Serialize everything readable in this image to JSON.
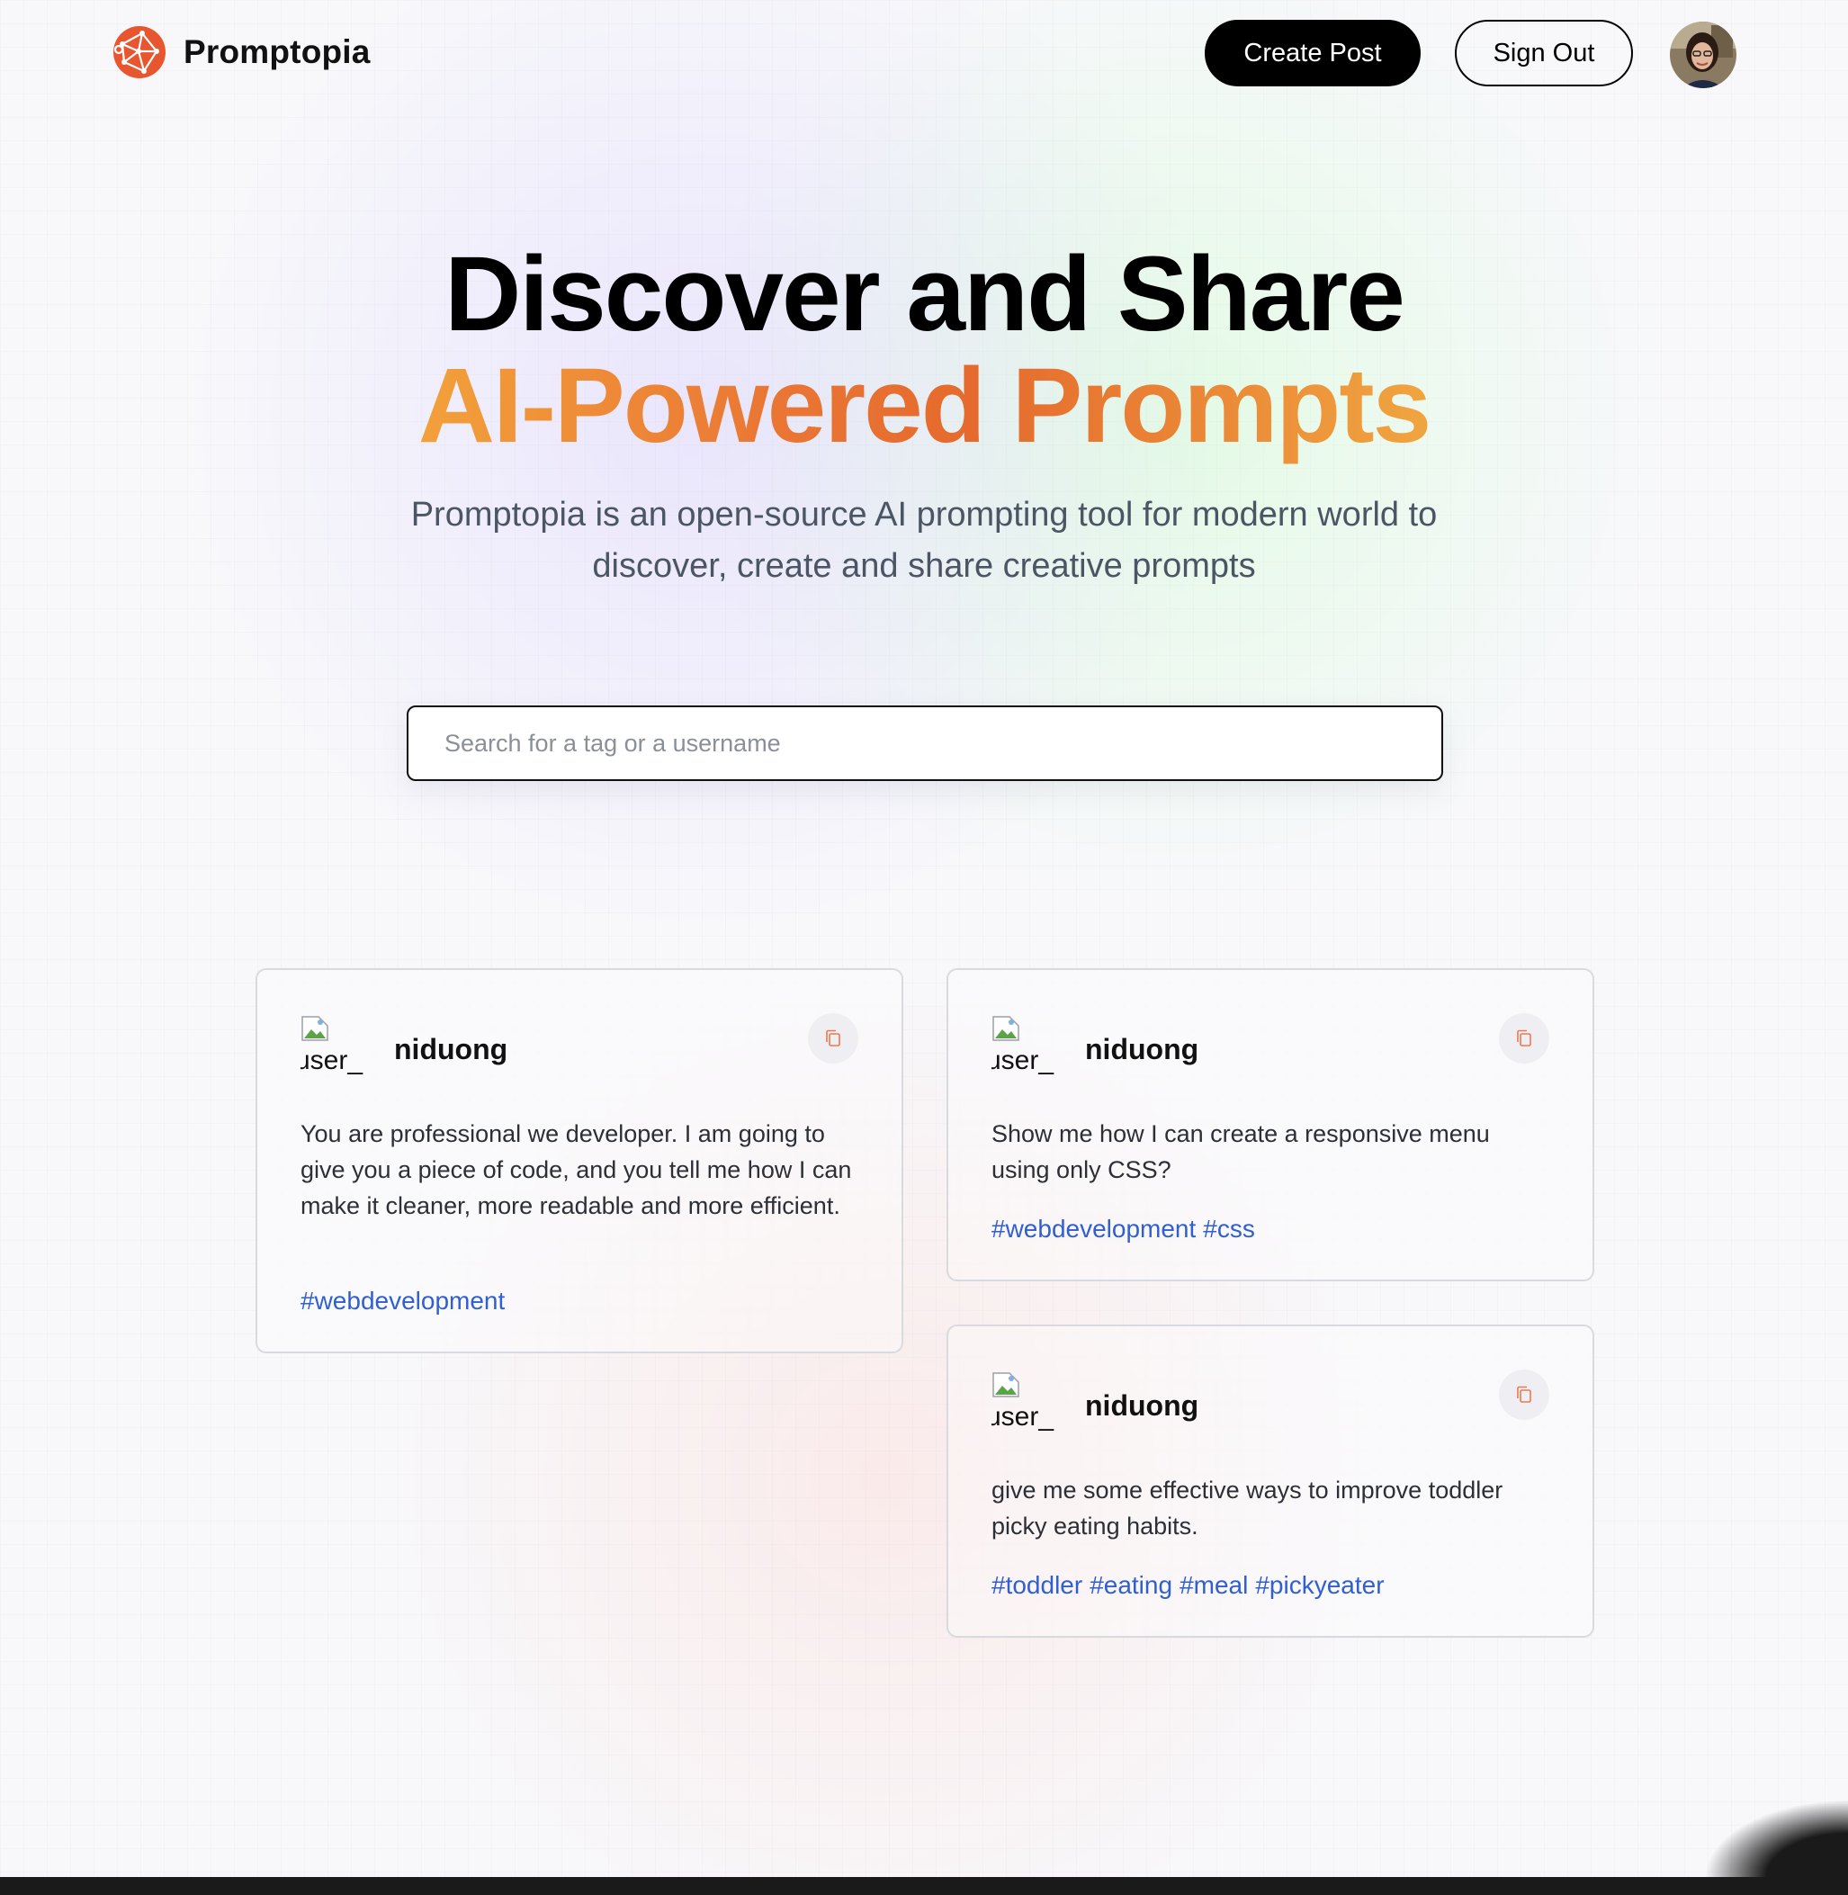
{
  "nav": {
    "brand": "Promptopia",
    "create_label": "Create Post",
    "signout_label": "Sign Out",
    "accent": "#e8562f"
  },
  "hero": {
    "line1": "Discover and Share",
    "line2": "AI-Powered Prompts",
    "subtitle": "Promptopia is an open-source AI prompting tool for modern world to discover, create and share creative prompts"
  },
  "search": {
    "placeholder": "Search for a tag or a username",
    "value": ""
  },
  "cards": [
    {
      "user_alt": "user_",
      "username": "niduong",
      "prompt": "You are professional we developer. I am going to give you a piece of code, and you tell me how I can make it cleaner, more readable and more efficient.",
      "tags": [
        "#webdevelopment"
      ]
    },
    {
      "user_alt": "user_",
      "username": "niduong",
      "prompt": "Show me how I can create a responsive menu using only CSS?",
      "tags": [
        "#webdevelopment",
        "#css"
      ]
    },
    {
      "user_alt": "user_",
      "username": "niduong",
      "prompt": "give me some effective ways to improve toddler picky eating habits.",
      "tags": [
        "#toddler",
        "#eating",
        "#meal",
        "#pickyeater"
      ]
    }
  ],
  "colors": {
    "tag": "#2f5fd0",
    "gradient_start": "#f2a13b",
    "gradient_mid": "#e56a2d"
  },
  "icons": {
    "logo": "globe-network-icon",
    "copy": "copy-icon",
    "broken_image": "broken-image-icon"
  }
}
